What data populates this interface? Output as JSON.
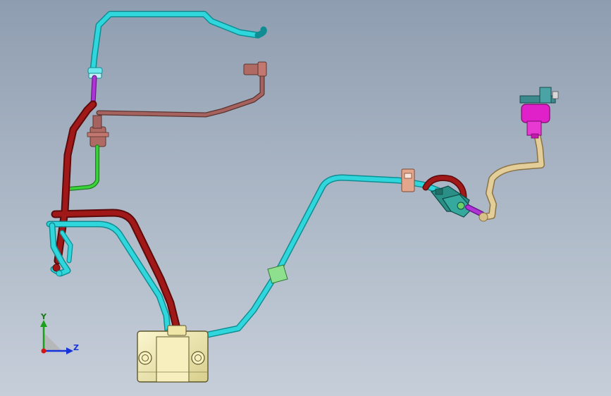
{
  "viewport": {
    "background_top": "#8e9db0",
    "background_bottom": "#c6ced9"
  },
  "colors": {
    "hose_cyan": "#2fd6dc",
    "hose_red": "#a01818",
    "hose_brown": "#9a5a56",
    "hose_tan": "#d8c08a",
    "hose_green": "#3ad33a",
    "hose_purple": "#b033d8",
    "housing_yellow": "#f3ebb0",
    "fitting_magenta": "#e020c8",
    "connector_teal": "#2a8f86",
    "clamp_green": "#8ee08e",
    "clamp_salmon": "#e3a68c"
  },
  "model_parts": [
    {
      "name": "cyan-coolant-hose",
      "color": "#2fd6dc"
    },
    {
      "name": "red-hose",
      "color": "#a01818"
    },
    {
      "name": "brown-vent-hose",
      "color": "#9a5a56"
    },
    {
      "name": "tan-hose",
      "color": "#d8c08a"
    },
    {
      "name": "green-hose",
      "color": "#3ad33a"
    },
    {
      "name": "reservoir-housing",
      "color": "#f3ebb0"
    },
    {
      "name": "magenta-fitting",
      "color": "#e020c8"
    },
    {
      "name": "quick-connector",
      "color": "#2a8f86"
    }
  ],
  "triad": {
    "y_label": "Y",
    "z_label": "Z",
    "y_color": "#1aa01a",
    "z_color": "#1533d8",
    "x_color": "#d81515"
  }
}
